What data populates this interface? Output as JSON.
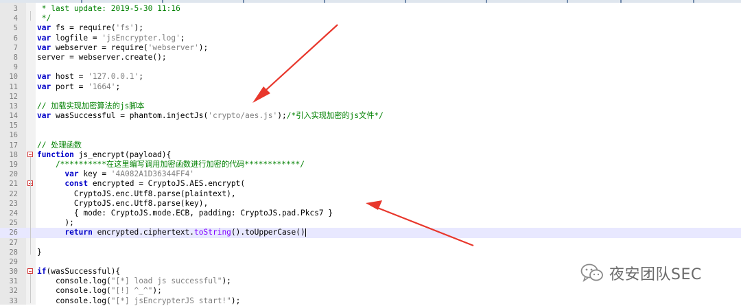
{
  "editor": {
    "lines": [
      {
        "n": "3",
        "segs": [
          [
            "cm",
            " * last update: 2019-5-30 11:16"
          ]
        ]
      },
      {
        "n": "4",
        "segs": [
          [
            "cm",
            " */"
          ]
        ]
      },
      {
        "n": "5",
        "segs": [
          [
            "kw",
            "var"
          ],
          [
            "",
            " fs = require("
          ],
          [
            "str",
            "'fs'"
          ],
          [
            "",
            ");"
          ]
        ]
      },
      {
        "n": "6",
        "segs": [
          [
            "kw",
            "var"
          ],
          [
            "",
            " logfile = "
          ],
          [
            "str",
            "'jsEncrypter.log'"
          ],
          [
            "",
            ";"
          ]
        ]
      },
      {
        "n": "7",
        "segs": [
          [
            "kw",
            "var"
          ],
          [
            "",
            " webserver = require("
          ],
          [
            "str",
            "'webserver'"
          ],
          [
            "",
            ");"
          ]
        ]
      },
      {
        "n": "8",
        "segs": [
          [
            "",
            "server = webserver.create();"
          ]
        ]
      },
      {
        "n": "9",
        "segs": []
      },
      {
        "n": "10",
        "segs": [
          [
            "kw",
            "var"
          ],
          [
            "",
            " host = "
          ],
          [
            "str",
            "'127.0.0.1'"
          ],
          [
            "",
            ";"
          ]
        ]
      },
      {
        "n": "11",
        "segs": [
          [
            "kw",
            "var"
          ],
          [
            "",
            " port = "
          ],
          [
            "str",
            "'1664'"
          ],
          [
            "",
            ";"
          ]
        ]
      },
      {
        "n": "12",
        "segs": []
      },
      {
        "n": "13",
        "segs": [
          [
            "cm",
            "// 加载实现加密算法的js脚本"
          ]
        ]
      },
      {
        "n": "14",
        "segs": [
          [
            "kw",
            "var"
          ],
          [
            "",
            " wasSuccessful = phantom.injectJs("
          ],
          [
            "str",
            "'crypto/aes.js'"
          ],
          [
            "",
            ");"
          ],
          [
            "cm",
            "/*引入实现加密的js文件*/"
          ]
        ]
      },
      {
        "n": "15",
        "segs": []
      },
      {
        "n": "16",
        "segs": []
      },
      {
        "n": "17",
        "segs": [
          [
            "cm",
            "// 处理函数"
          ]
        ]
      },
      {
        "n": "18",
        "segs": [
          [
            "kw",
            "function"
          ],
          [
            "",
            " js_encrypt(payload){"
          ]
        ]
      },
      {
        "n": "19",
        "segs": [
          [
            "cm",
            "    /**********在这里编写调用加密函数进行加密的代码************/"
          ]
        ]
      },
      {
        "n": "20",
        "segs": [
          [
            "",
            "      "
          ],
          [
            "kw",
            "var"
          ],
          [
            "",
            " key = "
          ],
          [
            "str",
            "'4A082A1D36344FF4'"
          ]
        ]
      },
      {
        "n": "21",
        "segs": [
          [
            "",
            "      "
          ],
          [
            "kw",
            "const"
          ],
          [
            "",
            " encrypted = CryptoJS.AES.encrypt("
          ]
        ]
      },
      {
        "n": "22",
        "segs": [
          [
            "",
            "        CryptoJS.enc.Utf8.parse(plaintext),"
          ]
        ]
      },
      {
        "n": "23",
        "segs": [
          [
            "",
            "        CryptoJS.enc.Utf8.parse(key),"
          ]
        ]
      },
      {
        "n": "24",
        "segs": [
          [
            "",
            "        { mode: CryptoJS.mode.ECB, padding: CryptoJS.pad.Pkcs7 }"
          ]
        ]
      },
      {
        "n": "25",
        "segs": [
          [
            "",
            "      );"
          ]
        ]
      },
      {
        "n": "26",
        "segs": [
          [
            "",
            "      "
          ],
          [
            "kw",
            "return"
          ],
          [
            "",
            " encrypted.ciphertext."
          ],
          [
            "fn",
            "toString"
          ],
          [
            "",
            "().toUpperCase()"
          ]
        ]
      },
      {
        "n": "27",
        "segs": []
      },
      {
        "n": "28",
        "segs": [
          [
            "",
            "}"
          ]
        ]
      },
      {
        "n": "29",
        "segs": []
      },
      {
        "n": "30",
        "segs": [
          [
            "kw",
            "if"
          ],
          [
            "",
            "(wasSuccessful){"
          ]
        ]
      },
      {
        "n": "31",
        "segs": [
          [
            "",
            "    console.log("
          ],
          [
            "str",
            "\"[*] load js successful\""
          ],
          [
            "",
            ");"
          ]
        ]
      },
      {
        "n": "32",
        "segs": [
          [
            "",
            "    console.log("
          ],
          [
            "str",
            "\"[!] ^_^\""
          ],
          [
            "",
            ");"
          ]
        ]
      },
      {
        "n": "33",
        "segs": [
          [
            "",
            "    console.log("
          ],
          [
            "str",
            "\"[*] jsEncrypterJS start!\""
          ],
          [
            "",
            ");"
          ]
        ]
      }
    ]
  },
  "watermark": {
    "text": "夜安团队SEC",
    "icon": "wechat-icon",
    "color": "#6b6b6b"
  },
  "annotations": {
    "arrow_color": "#e8372c"
  }
}
